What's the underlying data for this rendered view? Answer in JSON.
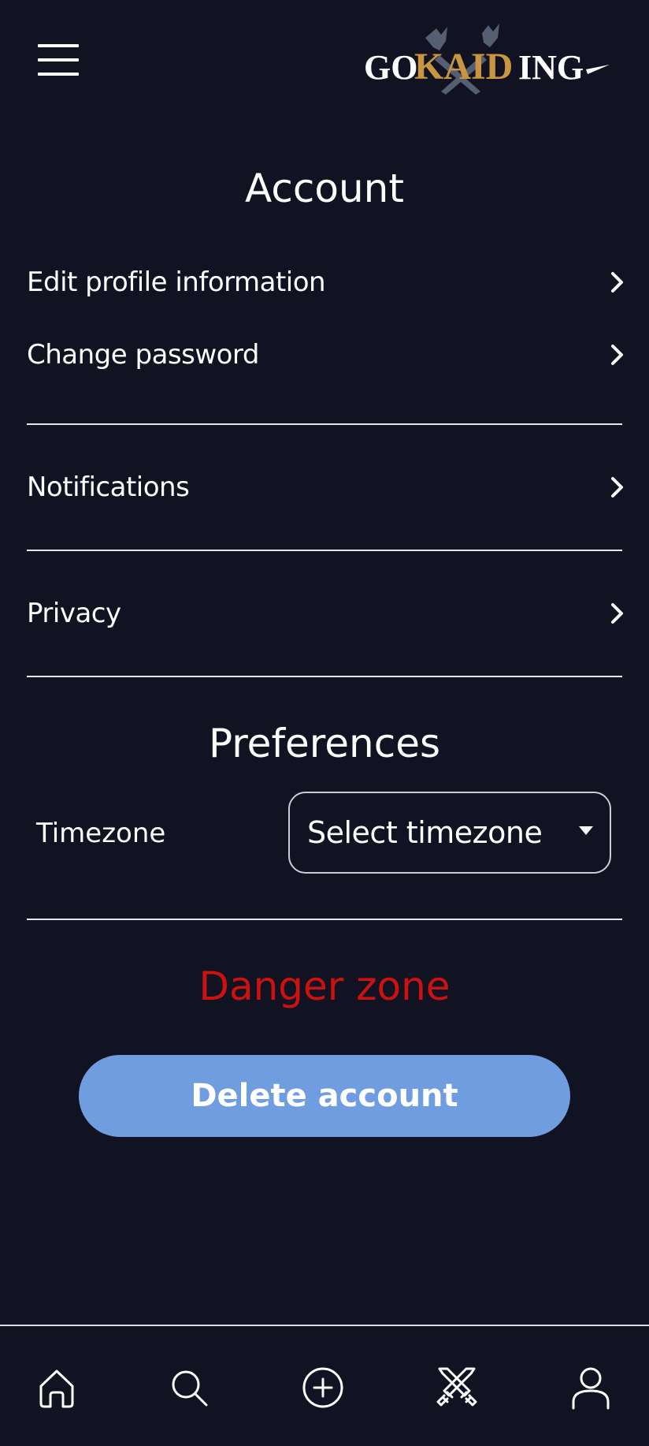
{
  "header": {
    "menu_icon": "hamburger-menu-icon",
    "logo": {
      "text_left": "GO",
      "text_middle": "KAID",
      "text_right": "ING",
      "accent_color": "#c8963e"
    }
  },
  "account": {
    "title": "Account",
    "items": [
      {
        "label": "Edit profile information",
        "icon": "chevron-right-icon"
      },
      {
        "label": "Change password",
        "icon": "chevron-right-icon"
      }
    ]
  },
  "notifications": {
    "label": "Notifications",
    "icon": "chevron-right-icon"
  },
  "privacy": {
    "label": "Privacy",
    "icon": "chevron-right-icon"
  },
  "preferences": {
    "title": "Preferences",
    "timezone": {
      "label": "Timezone",
      "value": "Select timezone",
      "icon": "caret-down-icon"
    }
  },
  "danger": {
    "title": "Danger zone",
    "delete_label": "Delete account",
    "title_color": "#cc1111",
    "button_color": "#6f9ddf"
  },
  "bottom_nav": {
    "items": [
      {
        "icon": "home-icon"
      },
      {
        "icon": "search-icon"
      },
      {
        "icon": "plus-circle-icon"
      },
      {
        "icon": "crossed-swords-icon"
      },
      {
        "icon": "user-icon"
      }
    ]
  },
  "theme": {
    "background": "#111322",
    "divider": "#e6e6ec"
  }
}
